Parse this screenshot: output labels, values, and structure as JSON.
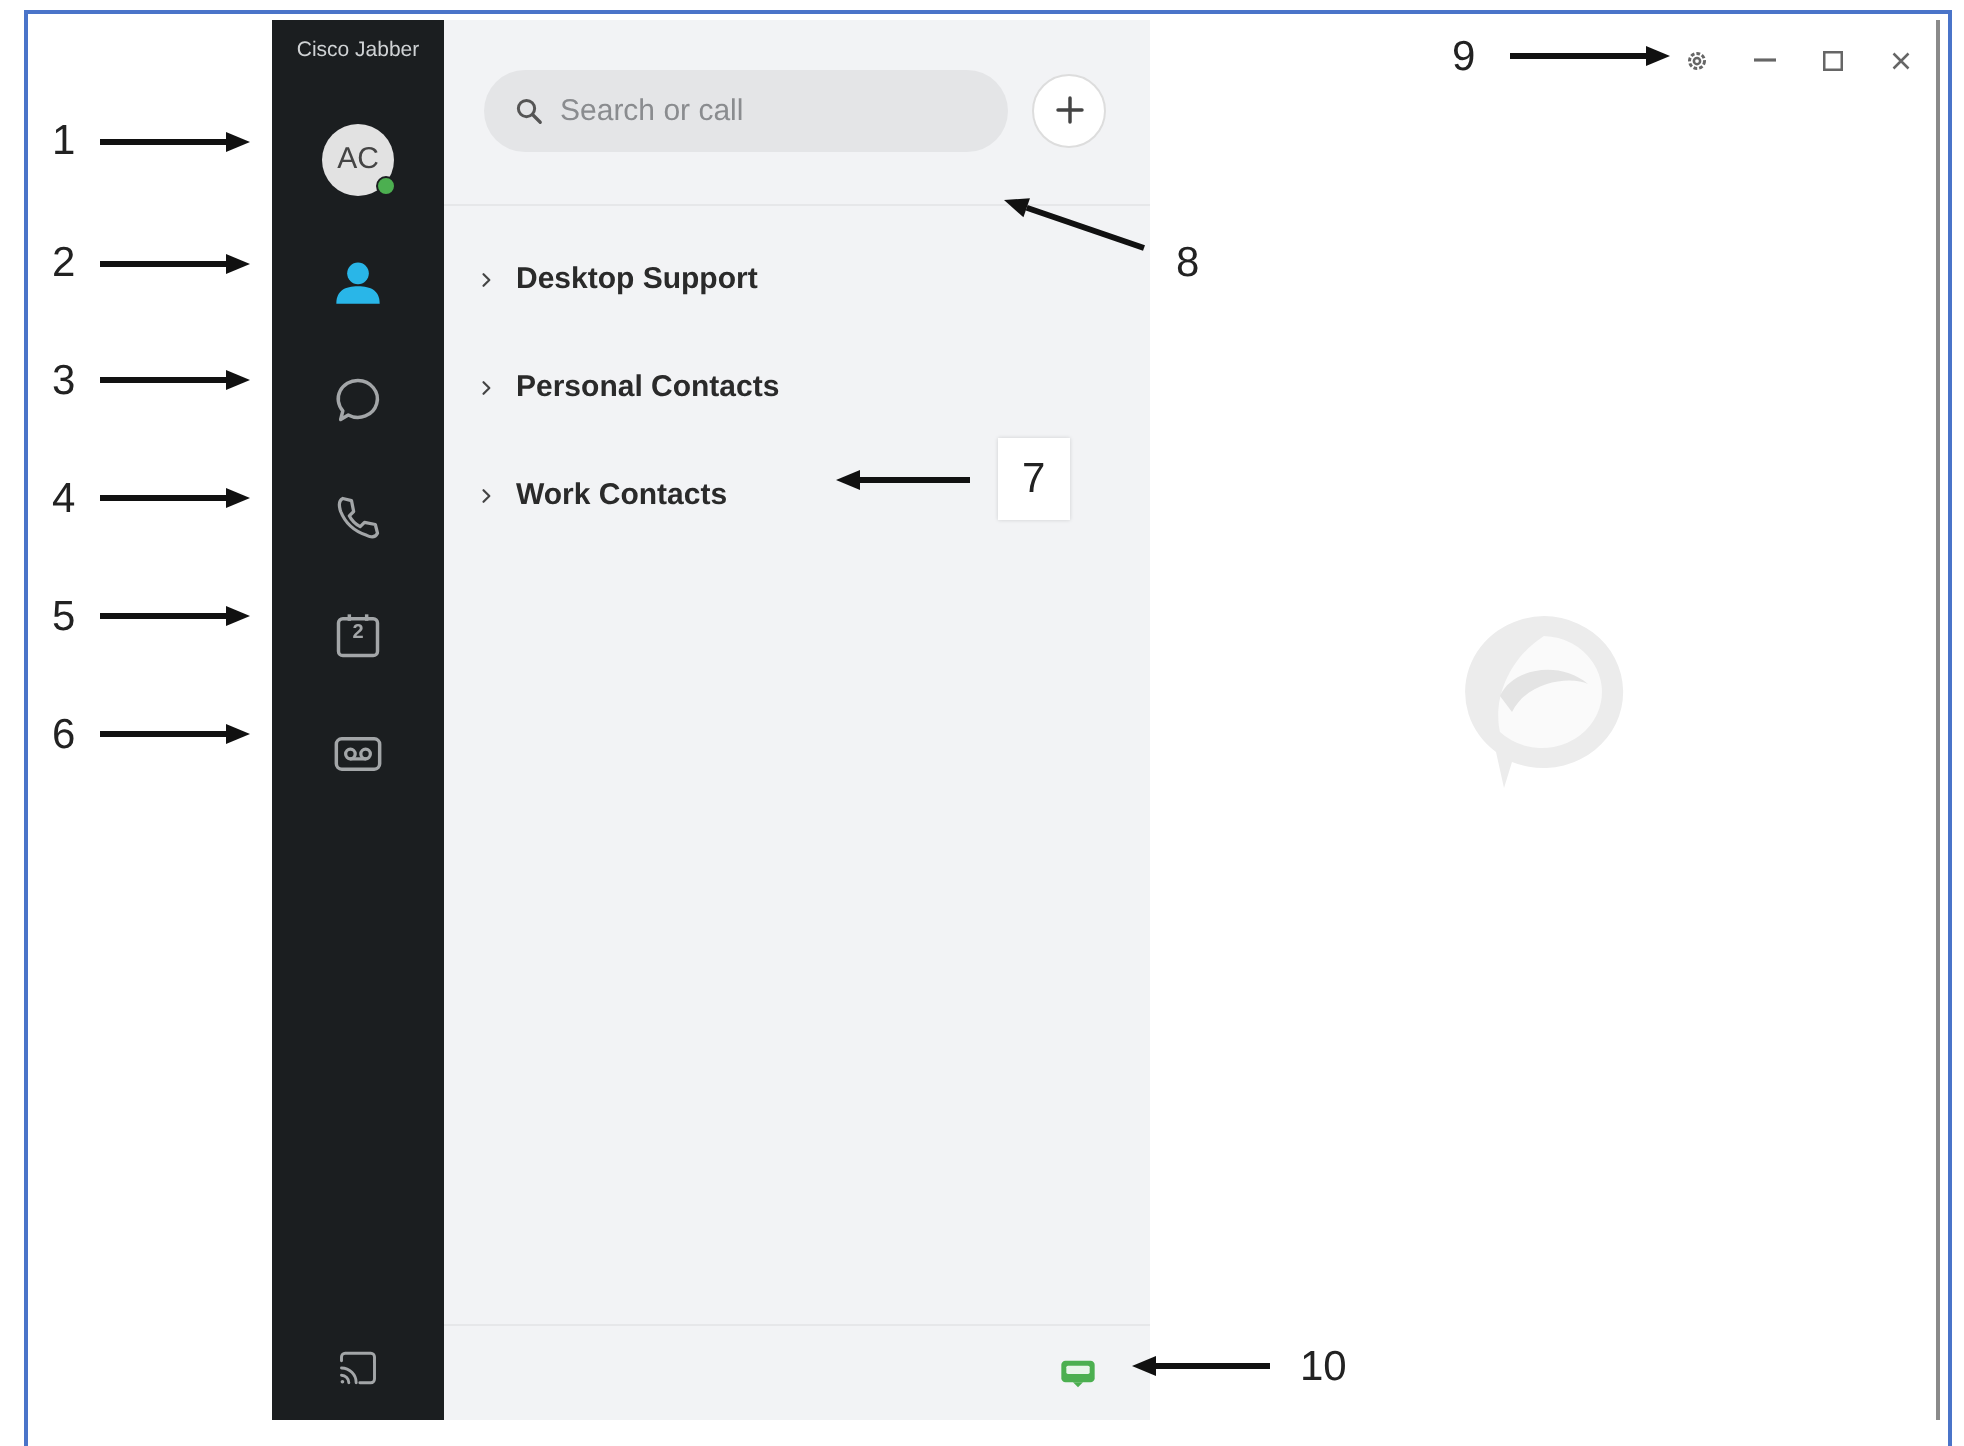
{
  "app": {
    "title": "Cisco Jabber"
  },
  "sidebar": {
    "avatar": {
      "initials": "AC",
      "available": true
    },
    "nav": [
      {
        "kind": "contacts",
        "selected": true
      },
      {
        "kind": "chat",
        "selected": false
      },
      {
        "kind": "calls",
        "selected": false
      },
      {
        "kind": "meetings",
        "selected": false,
        "label": "2"
      },
      {
        "kind": "voicemail",
        "selected": false
      }
    ]
  },
  "search": {
    "placeholder": "Search or call"
  },
  "groups": [
    {
      "label": "Desktop Support",
      "expanded": false
    },
    {
      "label": "Personal Contacts",
      "expanded": false
    },
    {
      "label": "Work Contacts",
      "expanded": false
    }
  ],
  "callouts": [
    {
      "label": "1"
    },
    {
      "label": "2"
    },
    {
      "label": "3"
    },
    {
      "label": "4"
    },
    {
      "label": "5"
    },
    {
      "label": "6"
    },
    {
      "label": "7"
    },
    {
      "label": "8"
    },
    {
      "label": "9"
    },
    {
      "label": "10"
    }
  ]
}
